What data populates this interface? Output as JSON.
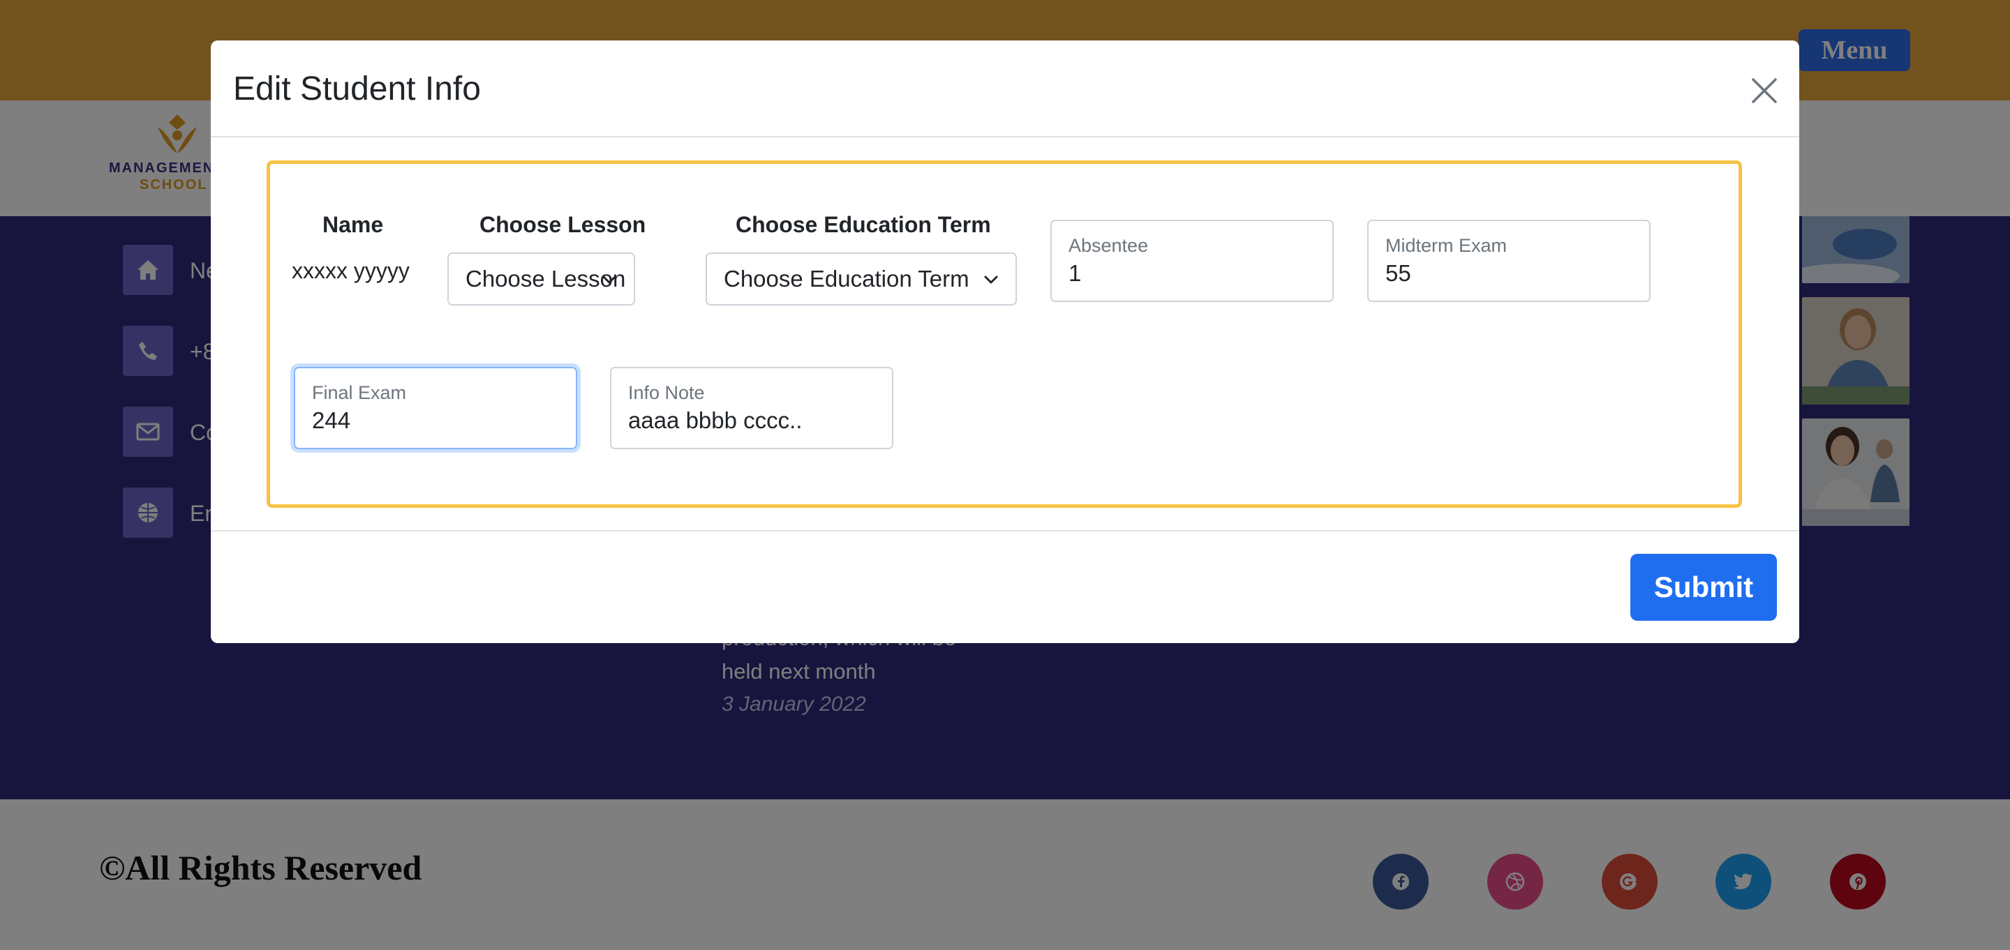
{
  "header": {
    "menu_label": "Menu"
  },
  "logo": {
    "line1": "MANAGEMENT",
    "line2": "SCHOOL"
  },
  "contact": {
    "items": [
      {
        "icon": "home-icon",
        "text": "Ne"
      },
      {
        "icon": "phone-icon",
        "text": "+8"
      },
      {
        "icon": "envelope-icon",
        "text": "Co"
      },
      {
        "icon": "globe-icon",
        "text": "En"
      }
    ]
  },
  "news": {
    "line1": "production, which will be",
    "line2": "held next month",
    "date": "3 January 2022"
  },
  "footer": {
    "copyright": "©All Rights Reserved",
    "social": [
      {
        "icon": "facebook-icon",
        "color": "#3b5998"
      },
      {
        "icon": "dribbble-icon",
        "color": "#ea4c89"
      },
      {
        "icon": "google-plus-icon",
        "color": "#dd4b39"
      },
      {
        "icon": "twitter-icon",
        "color": "#1da1f2"
      },
      {
        "icon": "pinterest-icon",
        "color": "#bd081c"
      }
    ]
  },
  "modal": {
    "title": "Edit Student Info",
    "close_icon": "close-icon",
    "name_label": "Name",
    "name_value": "xxxxx yyyyy",
    "lesson_label": "Choose Lesson",
    "lesson_selected": "Choose Lesson",
    "term_label": "Choose Education Term",
    "term_selected": "Choose Education Term",
    "absentee": {
      "label": "Absentee",
      "value": "1"
    },
    "midterm": {
      "label": "Midterm Exam",
      "value": "55"
    },
    "final": {
      "label": "Final Exam",
      "value": "244"
    },
    "info_note": {
      "label": "Info Note",
      "value": "aaaa bbbb cccc.."
    },
    "submit_label": "Submit"
  },
  "colors": {
    "topbar": "#e7a63a",
    "main_dark": "#2f2a7a",
    "form_border": "#f7c244",
    "submit": "#1f6ef0",
    "menu_button": "#2d6ce8"
  }
}
